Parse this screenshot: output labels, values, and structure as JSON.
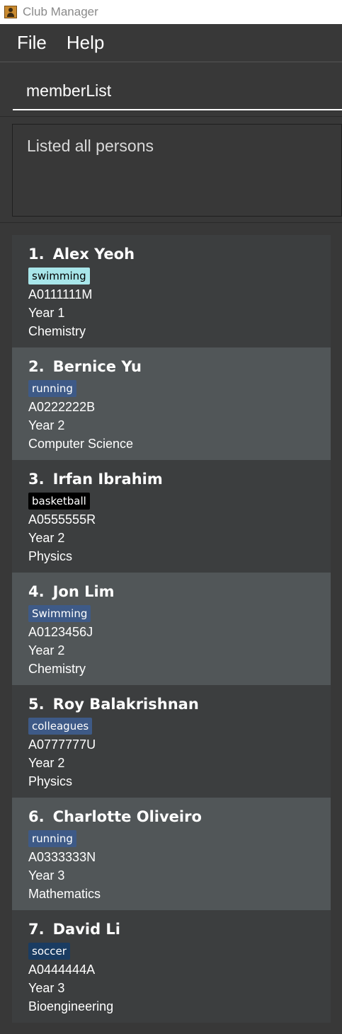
{
  "window": {
    "title": "Club Manager",
    "icon": "person-app-icon"
  },
  "menu": {
    "items": [
      "File",
      "Help"
    ]
  },
  "command": {
    "value": "memberList"
  },
  "result": {
    "text": "Listed all persons"
  },
  "persons": [
    {
      "index": "1.",
      "name": "Alex Yeoh",
      "tag": "swimming",
      "tag_bg": "#a8e6ea",
      "tag_fg": "#000000",
      "student_id": "A0111111M",
      "year": "Year 1",
      "major": "Chemistry"
    },
    {
      "index": "2.",
      "name": "Bernice Yu",
      "tag": "running",
      "tag_bg": "#3e5a87",
      "tag_fg": "#ffffff",
      "student_id": "A0222222B",
      "year": "Year 2",
      "major": "Computer Science"
    },
    {
      "index": "3.",
      "name": "Irfan Ibrahim",
      "tag": "basketball",
      "tag_bg": "#000000",
      "tag_fg": "#ffffff",
      "student_id": "A0555555R",
      "year": "Year 2",
      "major": "Physics"
    },
    {
      "index": "4.",
      "name": "Jon Lim",
      "tag": "Swimming",
      "tag_bg": "#3e5a87",
      "tag_fg": "#ffffff",
      "student_id": "A0123456J",
      "year": "Year 2",
      "major": "Chemistry"
    },
    {
      "index": "5.",
      "name": "Roy Balakrishnan",
      "tag": "colleagues",
      "tag_bg": "#3e5a87",
      "tag_fg": "#ffffff",
      "student_id": "A0777777U",
      "year": "Year 2",
      "major": "Physics"
    },
    {
      "index": "6.",
      "name": "Charlotte Oliveiro",
      "tag": "running",
      "tag_bg": "#3e5a87",
      "tag_fg": "#ffffff",
      "student_id": "A0333333N",
      "year": "Year 3",
      "major": "Mathematics"
    },
    {
      "index": "7.",
      "name": "David Li",
      "tag": "soccer",
      "tag_bg": "#1a3c62",
      "tag_fg": "#ffffff",
      "student_id": "A0444444A",
      "year": "Year 3",
      "major": "Bioengineering"
    }
  ]
}
